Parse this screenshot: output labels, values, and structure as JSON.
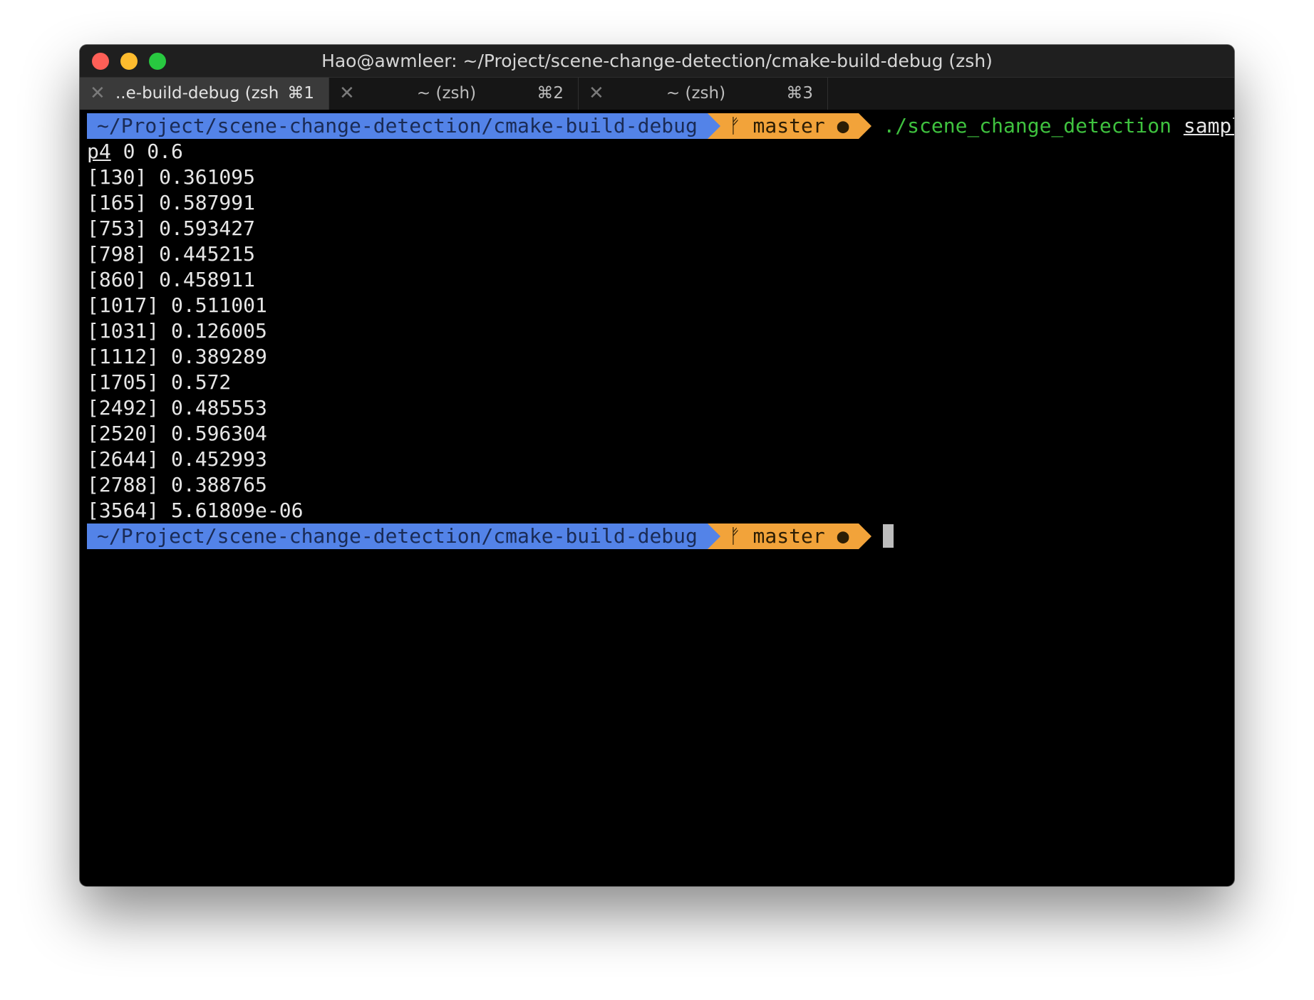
{
  "window": {
    "title": "Hao@awmleer: ~/Project/scene-change-detection/cmake-build-debug (zsh)"
  },
  "tabs": [
    {
      "close": "✕",
      "label": "..e-build-debug (zsh)",
      "shortcut": "⌘1"
    },
    {
      "close": "✕",
      "label": "~ (zsh)",
      "shortcut": "⌘2"
    },
    {
      "close": "✕",
      "label": "~ (zsh)",
      "shortcut": "⌘3"
    }
  ],
  "prompt": {
    "path": "~/Project/scene-change-detection/cmake-build-debug",
    "git_icon": "ᚠ",
    "branch": "master",
    "dirty_marker": "●"
  },
  "command": {
    "program": "./scene_change_detection",
    "arg": "sample.m"
  },
  "output": {
    "first_line_underlined": "p4",
    "first_line_rest": " 0 0.6",
    "lines": [
      "[130] 0.361095",
      "[165] 0.587991",
      "[753] 0.593427",
      "[798] 0.445215",
      "[860] 0.458911",
      "[1017] 0.511001",
      "[1031] 0.126005",
      "[1112] 0.389289",
      "[1705] 0.572",
      "[2492] 0.485553",
      "[2520] 0.596304",
      "[2644] 0.452993",
      "[2788] 0.388765",
      "[3564] 5.61809e-06"
    ]
  },
  "colors": {
    "prompt_path_bg": "#5383e8",
    "prompt_git_bg": "#f2a33a",
    "command_color": "#3fc23f",
    "terminal_bg": "#000000"
  }
}
